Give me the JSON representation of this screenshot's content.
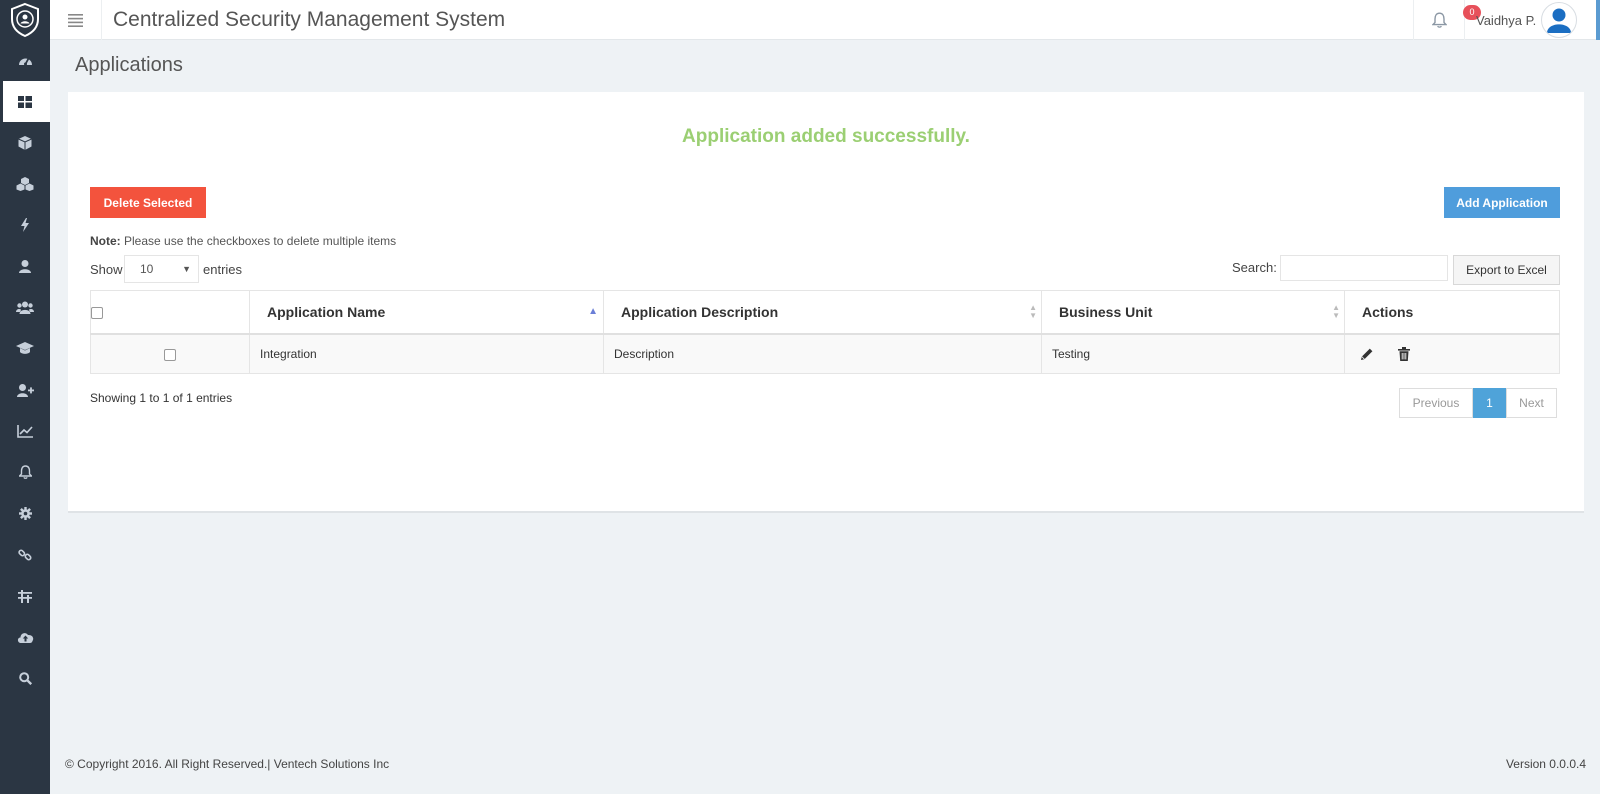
{
  "header": {
    "title": "Centralized Security Management System",
    "notification_count": "0",
    "user_name": "Vaidhya P."
  },
  "sidebar": {
    "items": [
      {
        "icon": "dashboard-icon"
      },
      {
        "icon": "applications-icon",
        "active": true
      },
      {
        "icon": "cube-icon"
      },
      {
        "icon": "cubes-icon"
      },
      {
        "icon": "bolt-icon"
      },
      {
        "icon": "user-icon"
      },
      {
        "icon": "users-icon"
      },
      {
        "icon": "graduation-cap-icon"
      },
      {
        "icon": "user-plus-icon"
      },
      {
        "icon": "line-chart-icon"
      },
      {
        "icon": "bell-icon"
      },
      {
        "icon": "gear-icon"
      },
      {
        "icon": "link-icon"
      },
      {
        "icon": "sliders-icon"
      },
      {
        "icon": "cloud-upload-icon"
      },
      {
        "icon": "search-icon"
      }
    ]
  },
  "page": {
    "title": "Applications",
    "success_message": "Application added successfully.",
    "delete_selected_label": "Delete Selected",
    "add_application_label": "Add Application",
    "note_prefix": "Note:",
    "note_text": " Please use the checkboxes to delete multiple items",
    "show_label": "Show",
    "page_size": "10",
    "entries_label": "entries",
    "search_label": "Search:",
    "search_value": "",
    "export_label": "Export to Excel"
  },
  "table": {
    "columns": [
      "",
      "Application Name",
      "Application Description",
      "Business Unit",
      "Actions"
    ],
    "rows": [
      {
        "name": "Integration",
        "description": "Description",
        "business_unit": "Testing"
      }
    ],
    "info": "Showing 1 to 1 of 1 entries",
    "pagination": {
      "previous": "Previous",
      "current": "1",
      "next": "Next"
    }
  },
  "footer": {
    "copyright": "© Copyright 2016. All Right Reserved.| Ventech Solutions Inc",
    "version": "Version 0.0.0.4"
  },
  "colors": {
    "sidebar_bg": "#2b3643",
    "success": "#9bcf73",
    "delete_button": "#f3533d",
    "add_button": "#4f9ddc",
    "badge": "#e7505a",
    "active_page": "#4fa3d9"
  }
}
